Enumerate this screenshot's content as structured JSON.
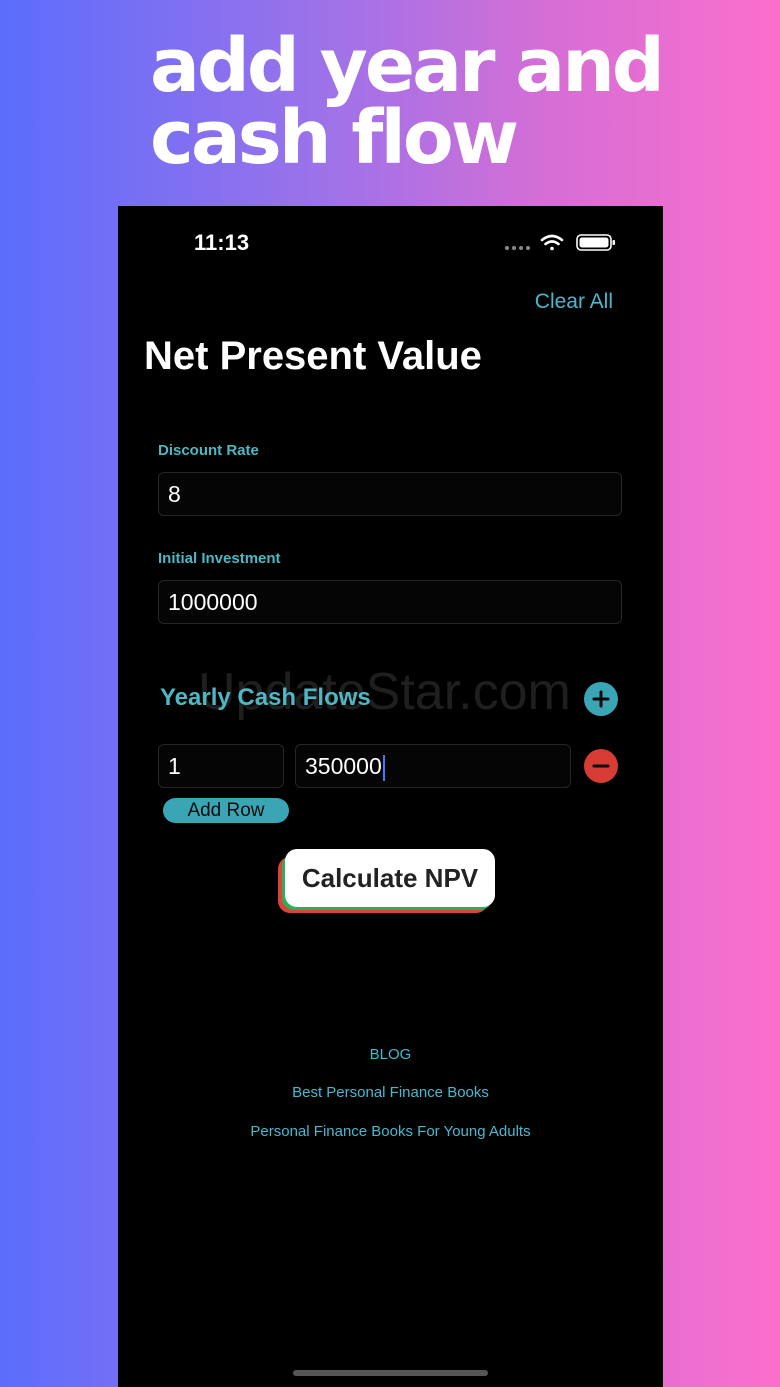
{
  "promo": {
    "line1": "add year and",
    "line2": "cash flow"
  },
  "status_bar": {
    "time": "11:13",
    "icons": [
      "signal-dots-icon",
      "wifi-icon",
      "battery-icon"
    ]
  },
  "nav": {
    "clear_all": "Clear All"
  },
  "page": {
    "title": "Net Present Value"
  },
  "discount_rate": {
    "label": "Discount Rate",
    "value": "8"
  },
  "initial_investment": {
    "label": "Initial Investment",
    "value": "1000000"
  },
  "watermark": "UpdateStar.com",
  "cash_flows": {
    "title": "Yearly Cash Flows",
    "rows": [
      {
        "year": "1",
        "amount": "350000"
      }
    ],
    "add_row_label": "Add Row"
  },
  "calculate_label": "Calculate NPV",
  "links": [
    "BLOG",
    "Best Personal Finance Books",
    "Personal Finance Books For Young Adults"
  ],
  "colors": {
    "accent": "#4fb6c3",
    "remove": "#d63b34",
    "background": "#000000"
  }
}
